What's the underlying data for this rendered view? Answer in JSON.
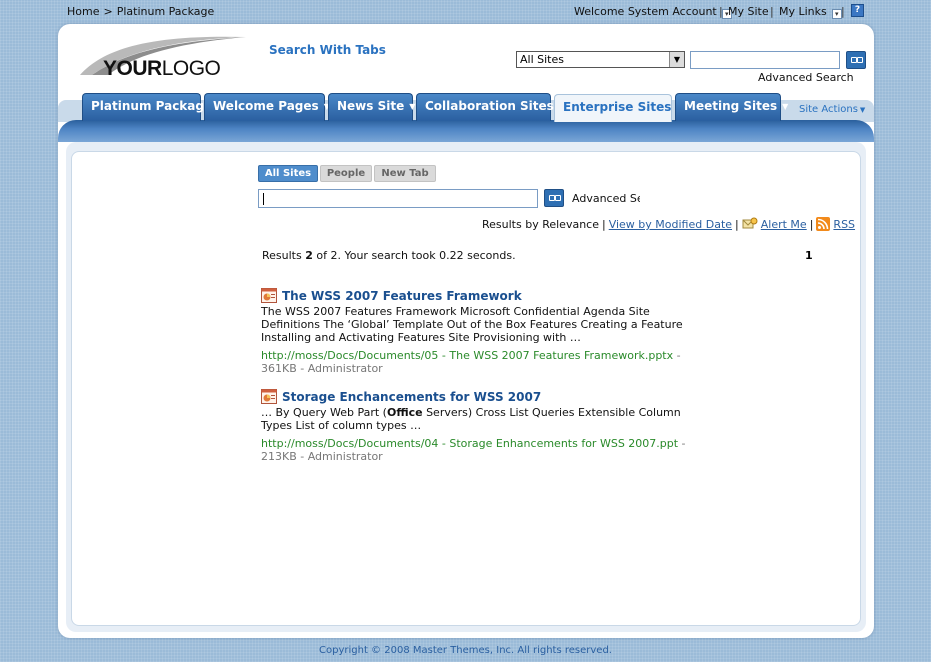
{
  "topbar": {
    "breadcrumb": [
      "Home",
      "Platinum Package"
    ],
    "breadcrumb_sep": ">",
    "welcome": "Welcome System Account",
    "my_site": "My Site",
    "my_links": "My Links",
    "help": "?"
  },
  "header": {
    "logo_bold": "YOUR",
    "logo_light": "LOGO",
    "site_title": "Search With Tabs",
    "scope": "All Sites",
    "search_value": "",
    "advanced_search": "Advanced Search"
  },
  "nav": {
    "tabs": [
      {
        "label": "Platinum Package",
        "caret": false
      },
      {
        "label": "Welcome Pages",
        "caret": true
      },
      {
        "label": "News Site",
        "caret": true
      },
      {
        "label": "Collaboration Sites",
        "caret": true
      },
      {
        "label": "Enterprise Sites",
        "caret": true,
        "active": true
      },
      {
        "label": "Meeting Sites",
        "caret": true
      }
    ],
    "site_actions": "Site Actions"
  },
  "search": {
    "tabs": [
      "All Sites",
      "People",
      "New Tab"
    ],
    "query": "",
    "advanced_link": "Advanced Sear",
    "sort": {
      "relevance": "Results by Relevance",
      "modified": "View by Modified Date",
      "alert": "Alert Me",
      "rss": "RSS"
    },
    "summary_prefix": "Results ",
    "summary_shown": "2",
    "summary_mid": " of 2. Your search took 0.22 seconds.",
    "page": "1"
  },
  "results": [
    {
      "title": "The WSS 2007 Features Framework",
      "description": "The WSS 2007 Features Framework Microsoft Confidential Agenda Site Definitions The ‘Global’ Template Out of the Box Features Creating a Feature Installing and Activating Features Site Provisioning with …",
      "url": "http://moss/Docs/Documents/05 - The WSS 2007 Features Framework.pptx",
      "size": " - 361KB - ",
      "author": "Administrator",
      "icon": "powerpoint-icon"
    },
    {
      "title": "Storage Enchancements for WSS 2007",
      "description_pre": "… By Query Web Part (",
      "description_bold": "Office",
      "description_post": " Servers) Cross List Queries Extensible Column Types List of column types …",
      "url": "http://moss/Docs/Documents/04 - Storage Enhancements for WSS 2007.ppt",
      "size": " - 213KB - ",
      "author": "Administrator",
      "icon": "powerpoint-icon"
    }
  ],
  "footer": "Copyright © 2008 Master Themes, Inc. All rights reserved.",
  "colors": {
    "accent": "#2a72c0",
    "tab_blue": "#2a5fa0",
    "url_green": "#2a8a2a",
    "background": "#9bbbd8"
  }
}
